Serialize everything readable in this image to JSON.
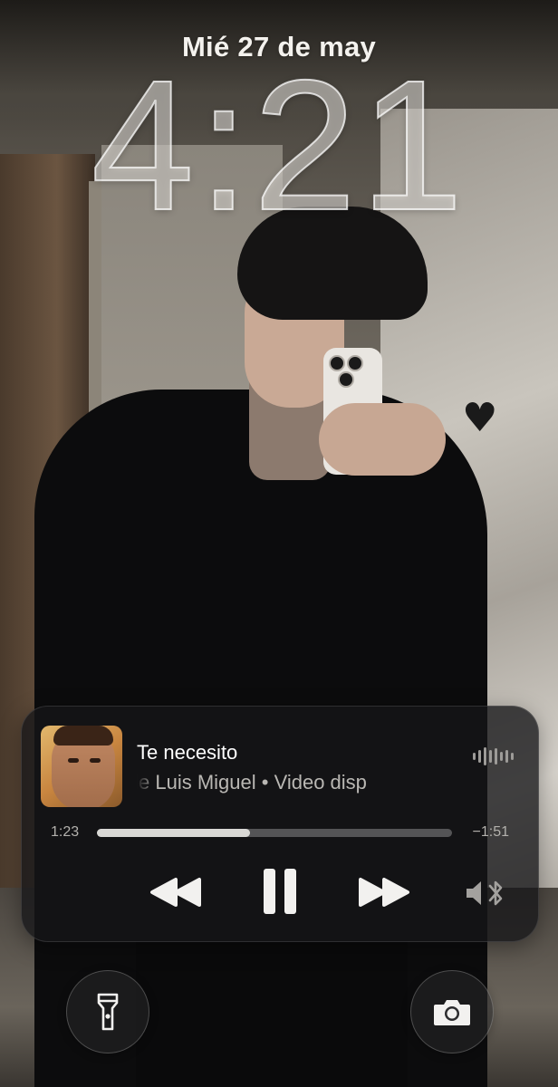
{
  "lock_screen": {
    "date": "Mié 27 de may",
    "time": "4:21"
  },
  "now_playing": {
    "title": "Te necesito",
    "subtitle_scrolling": "ible       Luis Miguel • Video disp",
    "elapsed": "1:23",
    "remaining": "−1:51",
    "progress_fraction": 0.43,
    "controls": {
      "rewind_icon": "backward-icon",
      "pause_icon": "pause-icon",
      "forward_icon": "forward-icon",
      "output_icon": "speaker-bluetooth-icon"
    },
    "waveform_icon": "audio-waveform-icon"
  },
  "quick_actions": {
    "left_icon": "flashlight-icon",
    "right_icon": "camera-icon"
  },
  "colors": {
    "text_primary": "#ffffff",
    "text_secondary": "#b9b7b3",
    "widget_bg": "#161618"
  }
}
